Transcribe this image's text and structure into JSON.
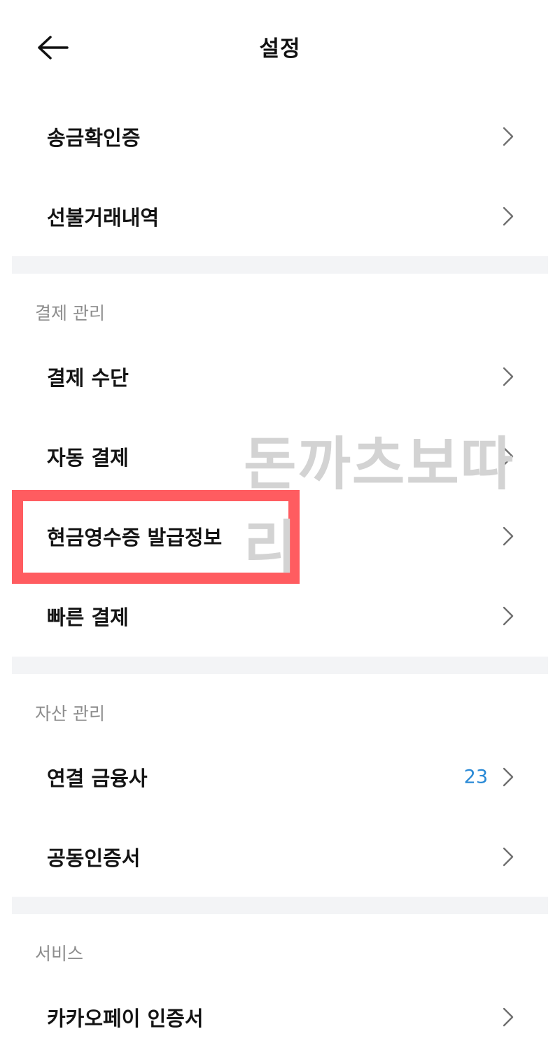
{
  "header": {
    "title": "설정",
    "back_icon": "arrow-left-icon"
  },
  "top_items": [
    {
      "label": "송금확인증"
    },
    {
      "label": "선불거래내역"
    }
  ],
  "payment": {
    "section_label": "결제 관리",
    "items": [
      {
        "label": "결제 수단"
      },
      {
        "label": "자동 결제"
      },
      {
        "label": "현금영수증 발급정보"
      },
      {
        "label": "빠른 결제"
      }
    ]
  },
  "assets": {
    "section_label": "자산 관리",
    "items": [
      {
        "label": "연결 금융사",
        "badge": "23"
      },
      {
        "label": "공동인증서"
      }
    ]
  },
  "service": {
    "section_label": "서비스",
    "items": [
      {
        "label": "카카오페이 인증서"
      }
    ]
  },
  "watermark": "돈까츠보따리",
  "colors": {
    "highlight": "#ff5c60",
    "badge": "#2a8ad6",
    "divider": "#f3f4f6"
  }
}
